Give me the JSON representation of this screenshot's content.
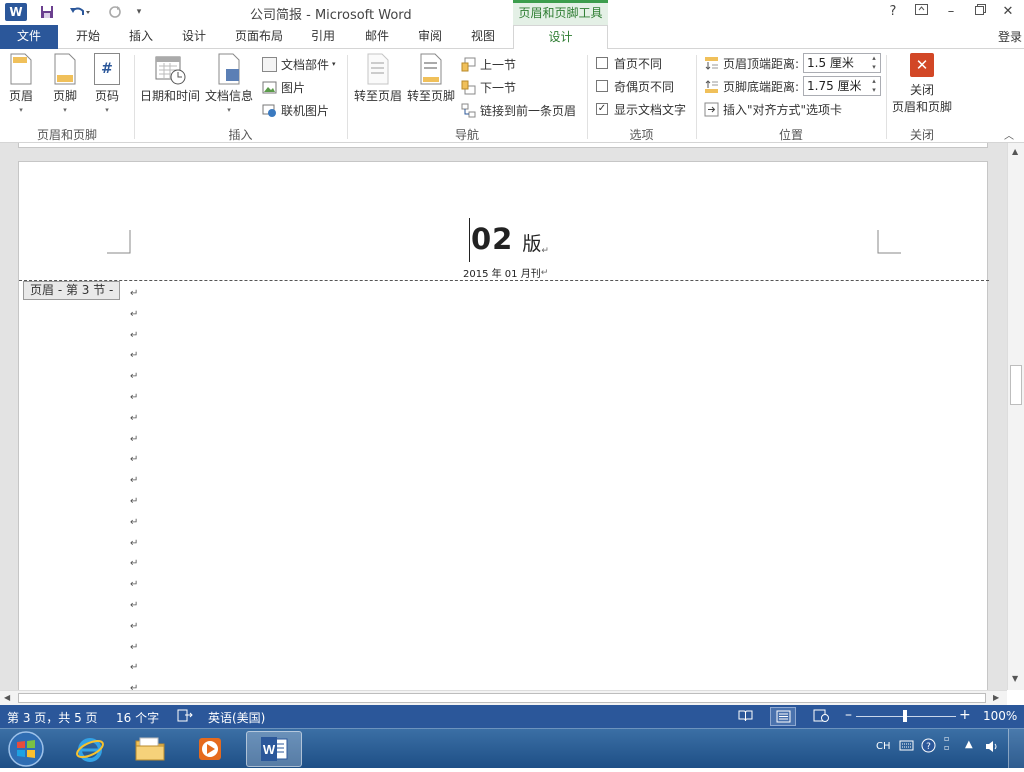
{
  "titlebar": {
    "title": "公司简报 - Microsoft Word",
    "tools_header": "页眉和页脚工具",
    "word_logo": "W",
    "help": "?"
  },
  "tabs": [
    {
      "label": "文件"
    },
    {
      "label": "开始"
    },
    {
      "label": "插入"
    },
    {
      "label": "设计"
    },
    {
      "label": "页面布局"
    },
    {
      "label": "引用"
    },
    {
      "label": "邮件"
    },
    {
      "label": "审阅"
    },
    {
      "label": "视图"
    },
    {
      "label": "设计"
    }
  ],
  "signin": "登录",
  "ribbon": {
    "hf_group": {
      "label": "页眉和页脚",
      "header": "页眉",
      "footer": "页脚",
      "page_number": "页码",
      "page_number_icon": "#"
    },
    "insert_group": {
      "label": "插入",
      "datetime": "日期和时间",
      "docinfo": "文档信息",
      "quickparts": "文档部件",
      "picture": "图片",
      "online_picture": "联机图片"
    },
    "nav_group": {
      "label": "导航",
      "goto_header": "转至页眉",
      "goto_footer": "转至页脚",
      "previous": "上一节",
      "next": "下一节",
      "link_previous": "链接到前一条页眉"
    },
    "options_group": {
      "label": "选项",
      "different_first": "首页不同",
      "different_odd_even": "奇偶页不同",
      "show_doc_text": "显示文档文字"
    },
    "position_group": {
      "label": "位置",
      "header_from_top_label": "页眉顶端距离:",
      "header_from_top_value": "1.5 厘米",
      "footer_from_bottom_label": "页脚底端距离:",
      "footer_from_bottom_value": "1.75 厘米",
      "insert_align_tab": "插入\"对齐方式\"选项卡"
    },
    "close_group": {
      "label": "关闭",
      "close_line1": "关闭",
      "close_line2": "页眉和页脚"
    }
  },
  "document": {
    "header_big": "02",
    "header_suffix": "版",
    "header_date": "2015 年 01 月刊",
    "header_tag": "页眉 - 第 3 节 -",
    "paragraph_mark": "↵"
  },
  "statusbar": {
    "page": "第 3 页，共 5 页",
    "words": "16 个字",
    "language": "英语(美国)",
    "zoom": "100%"
  },
  "tray": {
    "ime": "CH"
  },
  "colors": {
    "accent": "#2b579a",
    "tools_green": "#3c9d4d",
    "close_red": "#d24726"
  }
}
